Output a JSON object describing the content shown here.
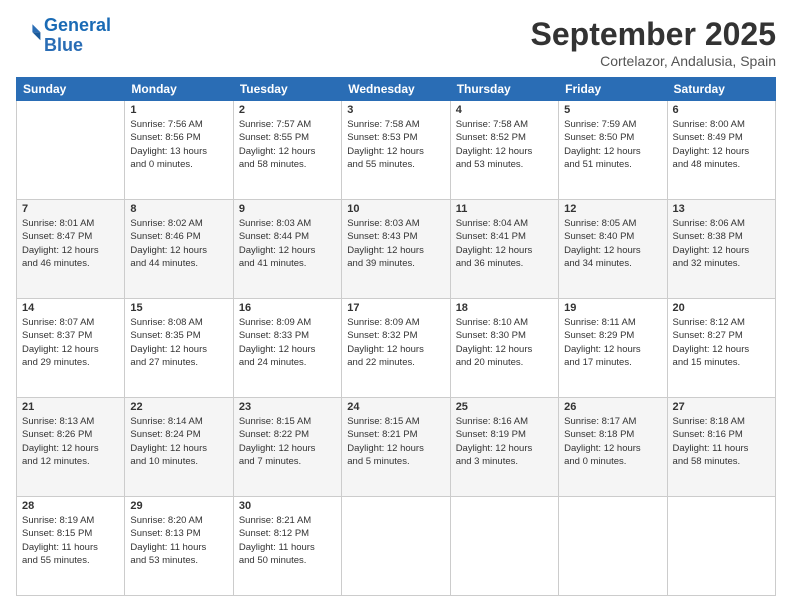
{
  "logo": {
    "line1": "General",
    "line2": "Blue"
  },
  "header": {
    "title": "September 2025",
    "subtitle": "Cortelazor, Andalusia, Spain"
  },
  "weekdays": [
    "Sunday",
    "Monday",
    "Tuesday",
    "Wednesday",
    "Thursday",
    "Friday",
    "Saturday"
  ],
  "weeks": [
    [
      {
        "day": "",
        "info": ""
      },
      {
        "day": "1",
        "info": "Sunrise: 7:56 AM\nSunset: 8:56 PM\nDaylight: 13 hours\nand 0 minutes."
      },
      {
        "day": "2",
        "info": "Sunrise: 7:57 AM\nSunset: 8:55 PM\nDaylight: 12 hours\nand 58 minutes."
      },
      {
        "day": "3",
        "info": "Sunrise: 7:58 AM\nSunset: 8:53 PM\nDaylight: 12 hours\nand 55 minutes."
      },
      {
        "day": "4",
        "info": "Sunrise: 7:58 AM\nSunset: 8:52 PM\nDaylight: 12 hours\nand 53 minutes."
      },
      {
        "day": "5",
        "info": "Sunrise: 7:59 AM\nSunset: 8:50 PM\nDaylight: 12 hours\nand 51 minutes."
      },
      {
        "day": "6",
        "info": "Sunrise: 8:00 AM\nSunset: 8:49 PM\nDaylight: 12 hours\nand 48 minutes."
      }
    ],
    [
      {
        "day": "7",
        "info": "Sunrise: 8:01 AM\nSunset: 8:47 PM\nDaylight: 12 hours\nand 46 minutes."
      },
      {
        "day": "8",
        "info": "Sunrise: 8:02 AM\nSunset: 8:46 PM\nDaylight: 12 hours\nand 44 minutes."
      },
      {
        "day": "9",
        "info": "Sunrise: 8:03 AM\nSunset: 8:44 PM\nDaylight: 12 hours\nand 41 minutes."
      },
      {
        "day": "10",
        "info": "Sunrise: 8:03 AM\nSunset: 8:43 PM\nDaylight: 12 hours\nand 39 minutes."
      },
      {
        "day": "11",
        "info": "Sunrise: 8:04 AM\nSunset: 8:41 PM\nDaylight: 12 hours\nand 36 minutes."
      },
      {
        "day": "12",
        "info": "Sunrise: 8:05 AM\nSunset: 8:40 PM\nDaylight: 12 hours\nand 34 minutes."
      },
      {
        "day": "13",
        "info": "Sunrise: 8:06 AM\nSunset: 8:38 PM\nDaylight: 12 hours\nand 32 minutes."
      }
    ],
    [
      {
        "day": "14",
        "info": "Sunrise: 8:07 AM\nSunset: 8:37 PM\nDaylight: 12 hours\nand 29 minutes."
      },
      {
        "day": "15",
        "info": "Sunrise: 8:08 AM\nSunset: 8:35 PM\nDaylight: 12 hours\nand 27 minutes."
      },
      {
        "day": "16",
        "info": "Sunrise: 8:09 AM\nSunset: 8:33 PM\nDaylight: 12 hours\nand 24 minutes."
      },
      {
        "day": "17",
        "info": "Sunrise: 8:09 AM\nSunset: 8:32 PM\nDaylight: 12 hours\nand 22 minutes."
      },
      {
        "day": "18",
        "info": "Sunrise: 8:10 AM\nSunset: 8:30 PM\nDaylight: 12 hours\nand 20 minutes."
      },
      {
        "day": "19",
        "info": "Sunrise: 8:11 AM\nSunset: 8:29 PM\nDaylight: 12 hours\nand 17 minutes."
      },
      {
        "day": "20",
        "info": "Sunrise: 8:12 AM\nSunset: 8:27 PM\nDaylight: 12 hours\nand 15 minutes."
      }
    ],
    [
      {
        "day": "21",
        "info": "Sunrise: 8:13 AM\nSunset: 8:26 PM\nDaylight: 12 hours\nand 12 minutes."
      },
      {
        "day": "22",
        "info": "Sunrise: 8:14 AM\nSunset: 8:24 PM\nDaylight: 12 hours\nand 10 minutes."
      },
      {
        "day": "23",
        "info": "Sunrise: 8:15 AM\nSunset: 8:22 PM\nDaylight: 12 hours\nand 7 minutes."
      },
      {
        "day": "24",
        "info": "Sunrise: 8:15 AM\nSunset: 8:21 PM\nDaylight: 12 hours\nand 5 minutes."
      },
      {
        "day": "25",
        "info": "Sunrise: 8:16 AM\nSunset: 8:19 PM\nDaylight: 12 hours\nand 3 minutes."
      },
      {
        "day": "26",
        "info": "Sunrise: 8:17 AM\nSunset: 8:18 PM\nDaylight: 12 hours\nand 0 minutes."
      },
      {
        "day": "27",
        "info": "Sunrise: 8:18 AM\nSunset: 8:16 PM\nDaylight: 11 hours\nand 58 minutes."
      }
    ],
    [
      {
        "day": "28",
        "info": "Sunrise: 8:19 AM\nSunset: 8:15 PM\nDaylight: 11 hours\nand 55 minutes."
      },
      {
        "day": "29",
        "info": "Sunrise: 8:20 AM\nSunset: 8:13 PM\nDaylight: 11 hours\nand 53 minutes."
      },
      {
        "day": "30",
        "info": "Sunrise: 8:21 AM\nSunset: 8:12 PM\nDaylight: 11 hours\nand 50 minutes."
      },
      {
        "day": "",
        "info": ""
      },
      {
        "day": "",
        "info": ""
      },
      {
        "day": "",
        "info": ""
      },
      {
        "day": "",
        "info": ""
      }
    ]
  ]
}
